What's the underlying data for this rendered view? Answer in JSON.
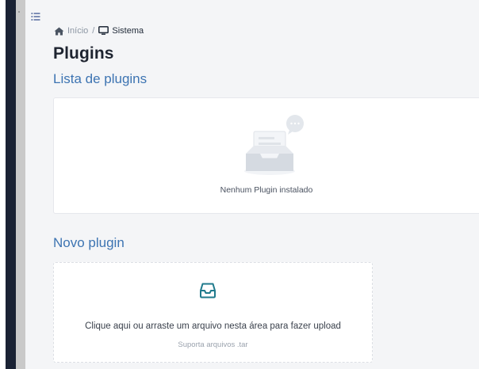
{
  "breadcrumb": {
    "home_label": "Início",
    "separator": "/",
    "current_label": "Sistema"
  },
  "page": {
    "title": "Plugins"
  },
  "plugins_list": {
    "section_title": "Lista de plugins",
    "empty_text": "Nenhum Plugin instalado"
  },
  "new_plugin": {
    "section_title": "Novo plugin",
    "upload_text": "Clique aqui ou arraste um arquivo nesta área para fazer upload",
    "upload_hint": "Suporta arquivos .tar"
  },
  "colors": {
    "accent": "#3d74b2",
    "sidebar_dark": "#1a2234",
    "upload_icon": "#1f7a8c"
  },
  "icons": {
    "menu": "list-menu-icon",
    "home": "home-icon",
    "system": "monitor-icon",
    "empty": "empty-inbox-illustration",
    "upload": "inbox-tray-icon"
  }
}
